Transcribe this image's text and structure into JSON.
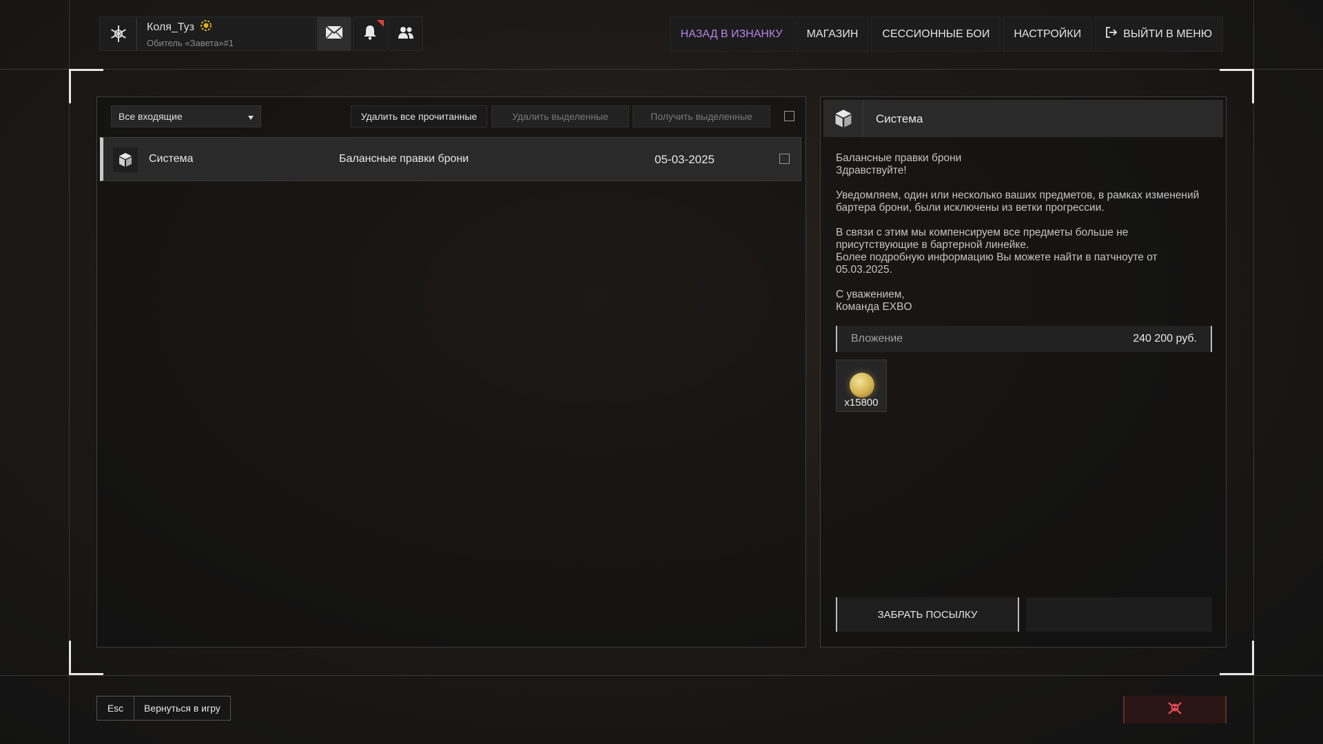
{
  "profile": {
    "username": "Коля_Туз",
    "clan": "Обитель «Завета»#1"
  },
  "topnav": {
    "back_to_underside": "НАЗАД В ИЗНАНКУ",
    "shop": "МАГАЗИН",
    "session_fights": "СЕССИОННЫЕ БОИ",
    "settings": "НАСТРОЙКИ",
    "exit_to_menu": "ВЫЙТИ В МЕНЮ"
  },
  "colors": {
    "accent": "#b782e8",
    "notification": "#e0403a",
    "danger": "#e04a55"
  },
  "mailbox": {
    "filter_selected": "Все входящие",
    "delete_all_read": "Удалить все прочитанные",
    "delete_selected": "Удалить выделенные",
    "receive_selected": "Получить выделенные",
    "messages": [
      {
        "sender": "Система",
        "subject": "Балансные правки брони",
        "date": "05-03-2025",
        "icon": "package-icon"
      }
    ]
  },
  "message_view": {
    "sender": "Система",
    "paragraphs": [
      "Балансные правки брони\nЗдравствуйте!",
      "Уведомляем, один или несколько ваших предметов, в рамках изменений бартера брони, были исключены из ветки прогрессии.",
      "В связи с этим мы компенсируем все предметы больше не присутствующие в бартерной линейке.\nБолее подробную информацию Вы можете найти в патчноуте от 05.03.2025.",
      "С уважением,\nКоманда EXBO"
    ],
    "attachment_label": "Вложение",
    "attachment_value": "240 200 руб.",
    "item": {
      "icon": "coin-icon",
      "quantity": "x15800"
    },
    "claim_button": "ЗАБРАТЬ ПОСЫЛКУ"
  },
  "bottom": {
    "esc_key": "Esc",
    "return_label": "Вернуться в игру"
  }
}
